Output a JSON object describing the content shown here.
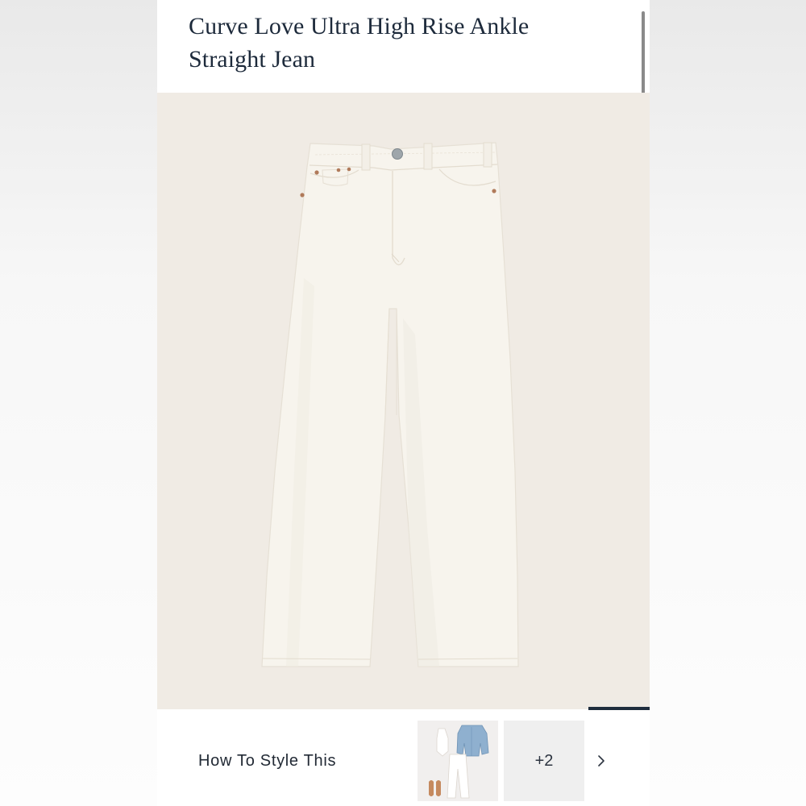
{
  "product": {
    "title": "Curve Love Ultra High Rise Ankle Straight Jean",
    "image_alt": "Curve Love Ultra High Rise Ankle Straight Jean in white denim"
  },
  "style_section": {
    "label": "How To Style This",
    "extra_count": "+2",
    "next_icon": "chevron-right-icon"
  },
  "colors": {
    "title": "#1d2a3b",
    "image_background": "#f0ebe4",
    "denim": "#f7f4ed",
    "indicator": "#1f2d3d"
  }
}
